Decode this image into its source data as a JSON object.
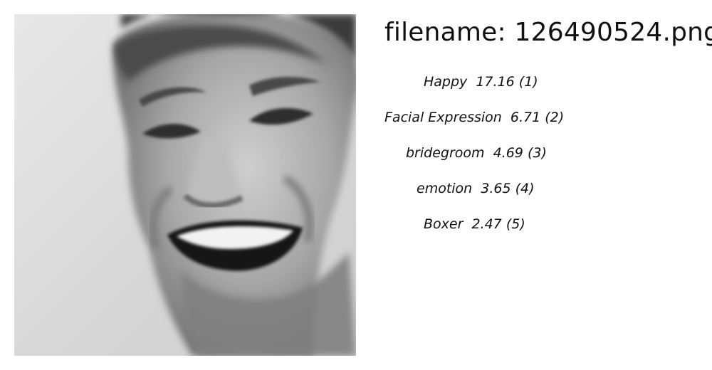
{
  "file": {
    "label": "filename:",
    "name": "126490524.png"
  },
  "image": {
    "description_icon": "face-photo"
  },
  "predictions": [
    {
      "name": "Happy",
      "score": "17.16",
      "rank": "(1)"
    },
    {
      "name": "Facial Expression",
      "score": "6.71",
      "rank": "(2)"
    },
    {
      "name": "bridegroom",
      "score": "4.69",
      "rank": "(3)"
    },
    {
      "name": "emotion",
      "score": "3.65",
      "rank": "(4)"
    },
    {
      "name": "Boxer",
      "score": "2.47",
      "rank": "(5)"
    }
  ]
}
